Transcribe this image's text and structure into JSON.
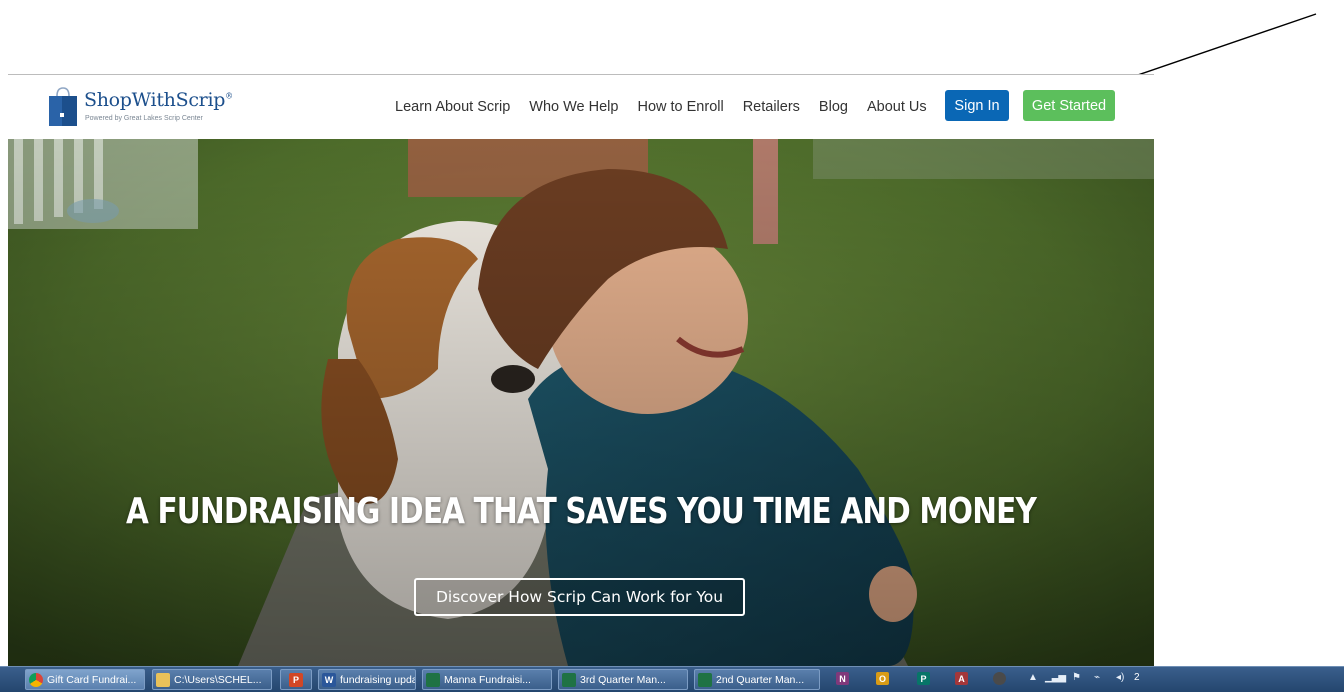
{
  "header": {
    "logo": {
      "name": "ShopWithScrip",
      "registered_mark": "®",
      "tagline": "Powered by Great Lakes Scrip Center"
    },
    "nav": [
      {
        "label": "Learn About Scrip"
      },
      {
        "label": "Who We Help"
      },
      {
        "label": "How to Enroll"
      },
      {
        "label": "Retailers"
      },
      {
        "label": "Blog"
      },
      {
        "label": "About Us"
      }
    ],
    "sign_in_label": "Sign In",
    "get_started_label": "Get Started"
  },
  "hero": {
    "headline": "A FUNDRAISING IDEA THAT SAVES YOU TIME AND MONEY",
    "cta_label": "Discover How Scrip Can Work for You"
  },
  "taskbar": {
    "items": [
      {
        "label": "Gift Card Fundrai...",
        "icon": "chrome-icon"
      },
      {
        "label": "C:\\Users\\SCHEL...",
        "icon": "folder-icon"
      },
      {
        "label": "",
        "icon": "powerpoint-icon",
        "glyph": "P"
      },
      {
        "label": "fundraising upda...",
        "icon": "word-icon",
        "glyph": "W"
      },
      {
        "label": "Manna Fundraisi...",
        "icon": "excel-icon"
      },
      {
        "label": "3rd Quarter Man...",
        "icon": "excel-icon"
      },
      {
        "label": "2nd Quarter Man...",
        "icon": "excel-icon"
      }
    ],
    "tray": [
      {
        "icon": "onenote-icon",
        "glyph": "N"
      },
      {
        "icon": "outlook-icon",
        "glyph": "O"
      },
      {
        "icon": "publisher-icon",
        "glyph": "P"
      },
      {
        "icon": "access-icon",
        "glyph": "A"
      },
      {
        "icon": "snipping-tool-icon",
        "glyph": ""
      }
    ],
    "clock_fragment": "2"
  },
  "colors": {
    "brand_blue": "#1c4f8c",
    "sign_in_blue": "#0a67b5",
    "get_started_green": "#5cbf5c",
    "taskbar": "#2c5079"
  }
}
